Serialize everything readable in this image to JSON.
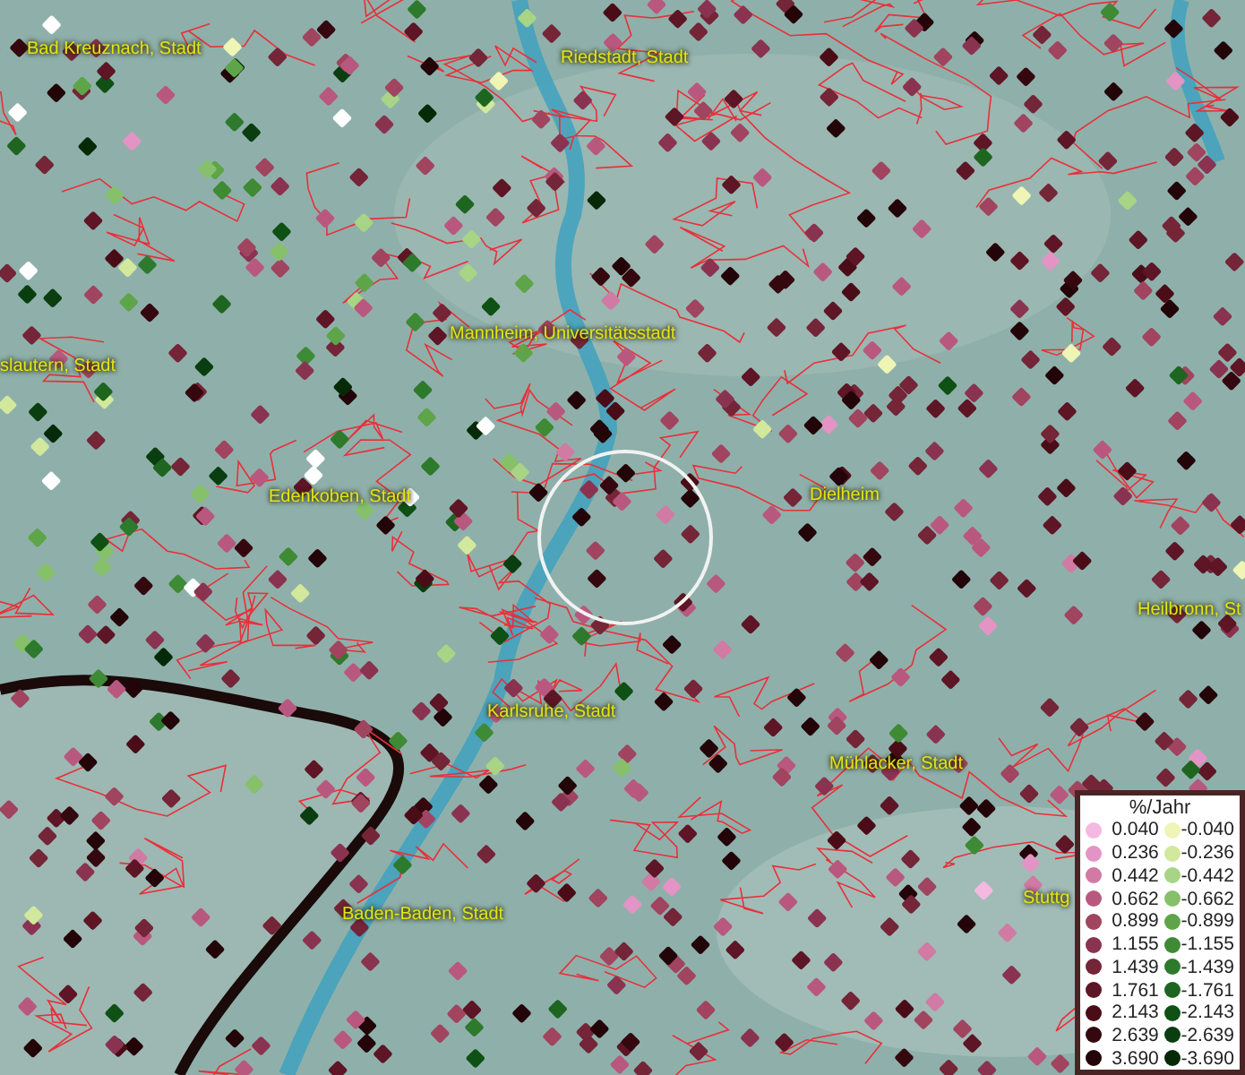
{
  "map": {
    "place_labels": [
      {
        "text": "Bad Kreuznach, Stadt"
      },
      {
        "text": "Riedstadt, Stadt"
      },
      {
        "text": "Mannheim, Universitätsstadt"
      },
      {
        "text": "slautern, Stadt"
      },
      {
        "text": "Edenkoben, Stadt"
      },
      {
        "text": "Dielheim"
      },
      {
        "text": "Heilbronn, St"
      },
      {
        "text": "Karlsruhe, Stadt"
      },
      {
        "text": "Mühlacker, Stadt"
      },
      {
        "text": "Baden-Baden, Stadt"
      },
      {
        "text": "Stuttg"
      }
    ]
  },
  "legend": {
    "title": "%/Jahr",
    "rows": [
      {
        "positive": {
          "label": "0.040",
          "color": "#f5b8e0"
        },
        "negative": {
          "label": "-0.040",
          "color": "#eef5b5"
        }
      },
      {
        "positive": {
          "label": "0.236",
          "color": "#e394c4"
        },
        "negative": {
          "label": "-0.236",
          "color": "#d2e89c"
        }
      },
      {
        "positive": {
          "label": "0.442",
          "color": "#d07aa4"
        },
        "negative": {
          "label": "-0.442",
          "color": "#a8d485"
        }
      },
      {
        "positive": {
          "label": "0.662",
          "color": "#b9587e"
        },
        "negative": {
          "label": "-0.662",
          "color": "#86c06a"
        }
      },
      {
        "positive": {
          "label": "0.899",
          "color": "#a0445f"
        },
        "negative": {
          "label": "-0.899",
          "color": "#5ea54a"
        }
      },
      {
        "positive": {
          "label": "1.155",
          "color": "#8a3350"
        },
        "negative": {
          "label": "-1.155",
          "color": "#3f8a35"
        }
      },
      {
        "positive": {
          "label": "1.439",
          "color": "#742537"
        },
        "negative": {
          "label": "-1.439",
          "color": "#2e7a2c"
        }
      },
      {
        "positive": {
          "label": "1.761",
          "color": "#5e1525"
        },
        "negative": {
          "label": "-1.761",
          "color": "#1e6620"
        }
      },
      {
        "positive": {
          "label": "2.143",
          "color": "#4a0d18"
        },
        "negative": {
          "label": "-2.143",
          "color": "#0f5015"
        }
      },
      {
        "positive": {
          "label": "2.639",
          "color": "#350810"
        },
        "negative": {
          "label": "-2.639",
          "color": "#0a3d10"
        }
      },
      {
        "positive": {
          "label": "3.690",
          "color": "#230408"
        },
        "negative": {
          "label": "-3.690",
          "color": "#062a08"
        }
      }
    ]
  }
}
